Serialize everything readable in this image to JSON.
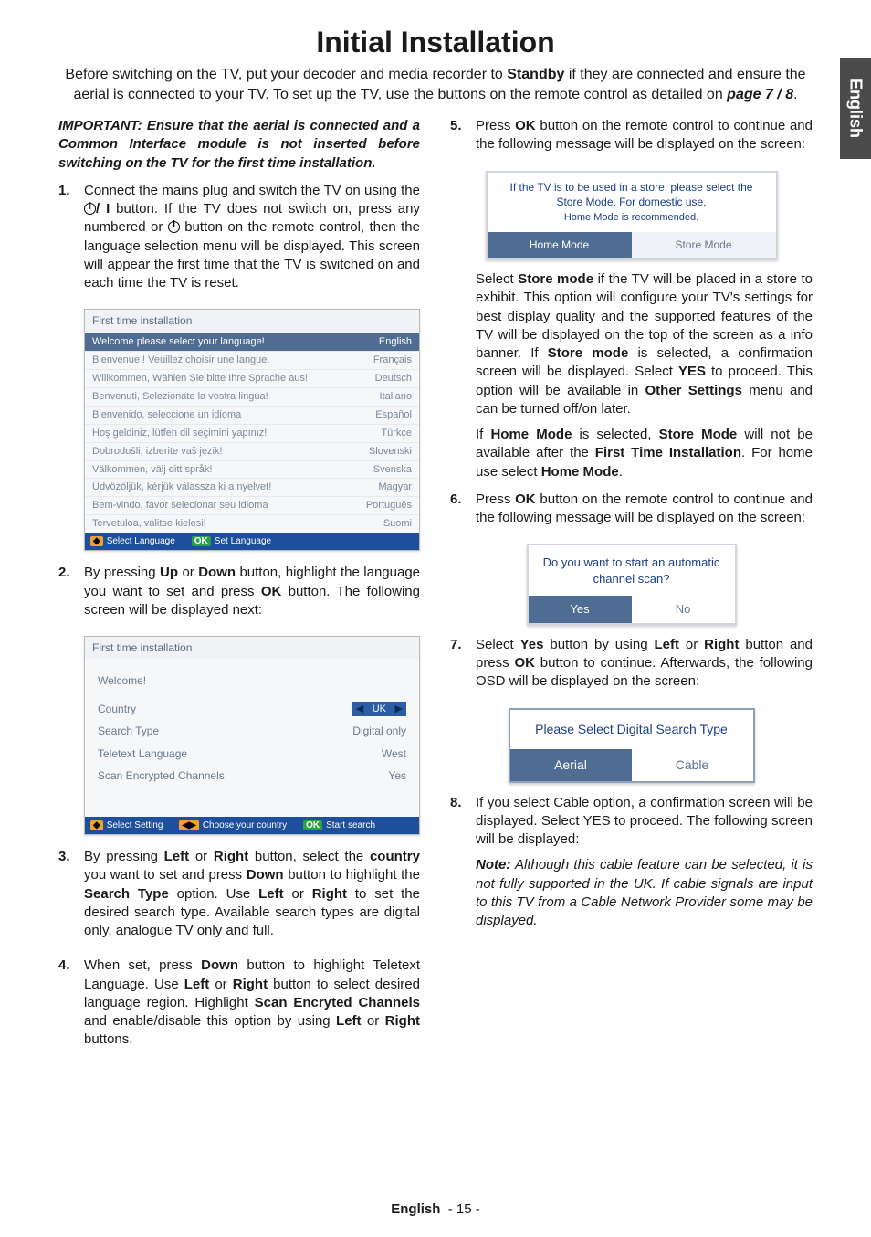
{
  "side_tab": "English",
  "page_title": "Initial Installation",
  "intro_parts": {
    "a": "Before switching on the TV, put your decoder and media recorder to ",
    "b": "Standby",
    "c": " if they are connected and ensure the aerial is connected to your TV. To set up the TV, use the buttons on the remote control as detailed on ",
    "d": "page 7 / 8",
    "e": "."
  },
  "important": "IMPORTANT: Ensure that the aerial is connected and a Common Interface module is not inserted before switching on the TV for the first time installation.",
  "steps": {
    "s1": {
      "num": "1.",
      "a": "Connect the mains plug and switch the TV on using the ",
      "b": "/ I",
      "c": " button. If the TV does not switch on, press any numbered or ",
      "d": " button on the remote control, then the language selection menu will be displayed. This screen will appear the first time that the TV is switched on and each time the TV is reset."
    },
    "s2": {
      "num": "2.",
      "a": "By pressing ",
      "b": "Up",
      "c": " or ",
      "d": "Down",
      "e": " button, highlight the language you want to set and press ",
      "f": "OK",
      "g": " button. The following screen will be displayed next:"
    },
    "s3": {
      "num": "3.",
      "a": "By pressing ",
      "b": "Left",
      "c": " or ",
      "d": "Right",
      "e": " button, select the ",
      "f": "country",
      "g": " you want to set and press ",
      "h": "Down",
      "i": " button to highlight the ",
      "j": "Search Type",
      "k": " option. Use ",
      "l": "Left",
      "m": " or ",
      "n": "Right",
      "o": " to set the desired search type. Available search types are digital only, analogue TV only and full."
    },
    "s4": {
      "num": "4.",
      "a": "When set, press ",
      "b": "Down",
      "c": " button to highlight Teletext Language. Use ",
      "d": "Left",
      "e": " or ",
      "f": "Right",
      "g": " button to select desired language region. Highlight ",
      "h": "Scan Encryted Channels",
      "i": " and enable/disable this option by using ",
      "j": "Left",
      "k": " or ",
      "l": "Right",
      "m": " buttons."
    },
    "s5": {
      "num": "5.",
      "a": "Press ",
      "b": "OK",
      "c": " button on the remote control to continue and the following message will be displayed on the screen:"
    },
    "s5b": {
      "a": "Select ",
      "b": "Store mode",
      "c": " if the TV will be placed in a store to exhibit. This option will configure your TV's settings for best display quality and the supported features of the TV will be displayed on the top of the screen as a info banner. If ",
      "d": "Store mode",
      "e": " is selected, a confirmation screen will be displayed. Select ",
      "f": "YES",
      "g": " to proceed. This option will be available in ",
      "h": "Other Settings",
      "i": " menu and can be turned off/on later."
    },
    "s5c": {
      "a": "If ",
      "b": "Home Mode",
      "c": " is selected, ",
      "d": "Store Mode",
      "e": " will not be available after the ",
      "f": "First Time Installation",
      "g": ". For home use select ",
      "h": "Home Mode",
      "i": "."
    },
    "s6": {
      "num": "6.",
      "a": "Press ",
      "b": "OK",
      "c": " button on the remote control to continue and the following message will be displayed on the screen:"
    },
    "s7": {
      "num": "7.",
      "a": "Select ",
      "b": "Yes",
      "c": " button by using ",
      "d": "Left",
      "e": " or ",
      "f": "Right",
      "g": " button and press ",
      "h": "OK",
      "i": " button to continue. Afterwards, the following OSD will be displayed on the screen:"
    },
    "s8": {
      "num": "8.",
      "a": "If you select Cable option, a confirmation screen will be displayed. Select YES to proceed. The following screen will be displayed:"
    },
    "note": {
      "a": "Note:",
      "b": " Although this cable feature can be selected, it is not fully supported in the UK. If cable signals are input to this TV from a Cable Network Provider some may be displayed."
    }
  },
  "shot1": {
    "title": "First time installation",
    "head_left": "Welcome please select your language!",
    "head_right": "English",
    "rows": [
      [
        "Bienvenue ! Veuillez choisir une langue.",
        "Français"
      ],
      [
        "Willkommen, Wählen Sie bitte Ihre Sprache aus!",
        "Deutsch"
      ],
      [
        "Benvenuti, Selezionate la vostra lingua!",
        "Italiano"
      ],
      [
        "Bienvenido, seleccione un idioma",
        "Español"
      ],
      [
        "Hoş geldiniz, lütfen dil seçimini yapınız!",
        "Türkçe"
      ],
      [
        "Dobrodošli, izberite vaš jezik!",
        "Slovenski"
      ],
      [
        "Välkommen, välj ditt språk!",
        "Svenska"
      ],
      [
        "Üdvözöljük, kérjük válassza ki a nyelvet!",
        "Magyar"
      ],
      [
        "Bem-vindo, favor selecionar seu idioma",
        "Português"
      ],
      [
        "Tervetuloa, valitse kielesi!",
        "Suomi"
      ]
    ],
    "foot1": "Select Language",
    "foot2": "Set Language"
  },
  "shot2": {
    "title": "First time installation",
    "welcome": "Welcome!",
    "rows": {
      "country_l": "Country",
      "country_v": "UK",
      "search_l": "Search Type",
      "search_v": "Digital only",
      "ttx_l": "Teletext Language",
      "ttx_v": "West",
      "enc_l": "Scan Encrypted Channels",
      "enc_v": "Yes"
    },
    "foot1": "Select Setting",
    "foot2": "Choose your country",
    "foot3": "Start search"
  },
  "modebox": {
    "msg": "If the TV is to be used in a store, please select the Store Mode. For domestic use,",
    "msg2": "Home Mode is recommended.",
    "home": "Home Mode",
    "store": "Store Mode"
  },
  "scanbox": {
    "msg": "Do you want to start an automatic channel scan?",
    "yes": "Yes",
    "no": "No"
  },
  "searchbox": {
    "msg": "Please Select Digital Search Type",
    "aerial": "Aerial",
    "cable": "Cable"
  },
  "footer": {
    "lang": "English",
    "page": "- 15 -"
  }
}
